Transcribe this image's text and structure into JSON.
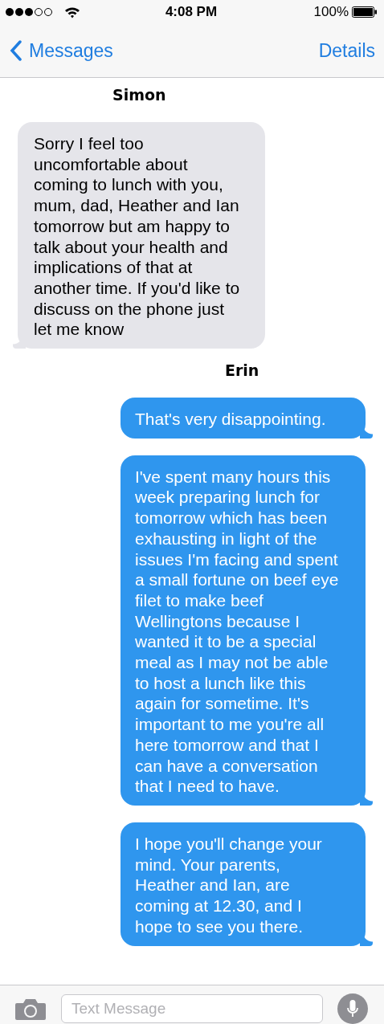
{
  "status_bar": {
    "time": "4:08 PM",
    "battery": "100%"
  },
  "nav_bar": {
    "back": "Messages",
    "action": "Details"
  },
  "groups": [
    {
      "sender": "Simon",
      "kind": "received",
      "messages": [
        "Sorry I feel too uncomfortable about coming to lunch with you, mum, dad, Heather and Ian tomorrow but am happy to talk about your health and implications of that at another time. If you'd like to discuss on the phone just let me know"
      ]
    },
    {
      "sender": "Erin",
      "kind": "sent",
      "messages": [
        "That's very disappointing.",
        "I've spent many hours this week preparing lunch for tomorrow which has been exhausting in light of the issues I'm facing and spent a small fortune on beef eye filet to make beef Wellingtons because I wanted it to be a special meal as I may not be able to host a lunch like this again for sometime. It's important to me you're all here tomorrow and that I can have a conversation that I need to have.",
        "I hope you'll change your mind. Your parents, Heather and Ian, are coming at 12.30, and I hope to see you there."
      ]
    }
  ],
  "composer": {
    "placeholder": "Text Message"
  }
}
